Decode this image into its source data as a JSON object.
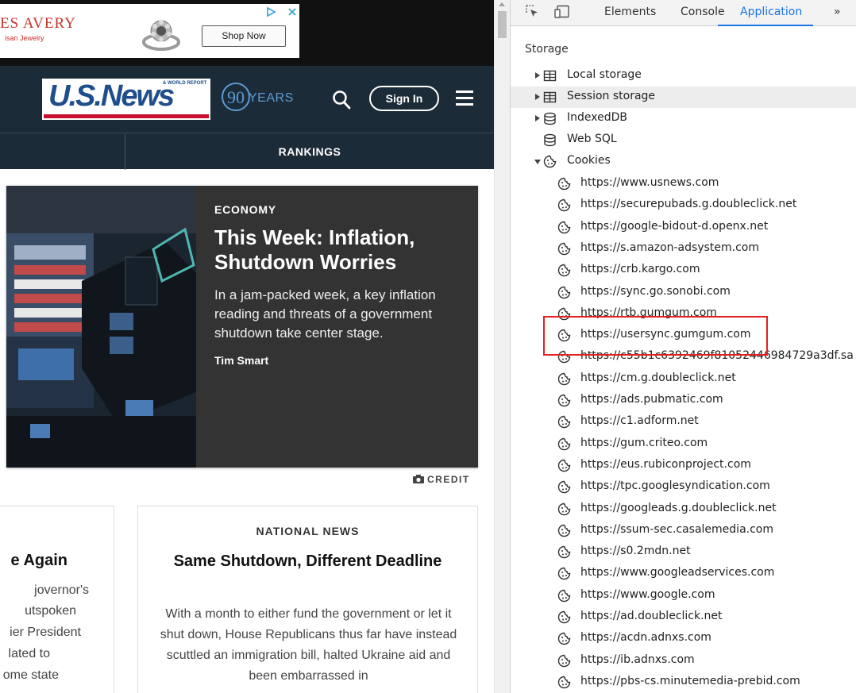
{
  "ad": {
    "brand": "ES AVERY",
    "tagline": "isan Jewelry",
    "shop_label": "Shop Now"
  },
  "site": {
    "logo_text": "U.S.News",
    "logo_small": "& WORLD REPORT",
    "anniversary_number": "90",
    "anniversary_label": "YEARS",
    "signin_label": "Sign In",
    "nav_item": "RANKINGS"
  },
  "hero": {
    "kicker": "ECONOMY",
    "title": "This Week: Inflation, Shutdown Worries",
    "summary": "In a jam-packed week, a key inflation reading and threats of a government shutdown take center stage.",
    "author": "Tim Smart",
    "credit": "CREDIT"
  },
  "card_left": {
    "title": "e Again",
    "lines": [
      "jovernor's",
      "utspoken",
      "ier President",
      "lated to",
      "ome state"
    ]
  },
  "card_right": {
    "kicker": "NATIONAL NEWS",
    "title": "Same Shutdown, Different Deadline",
    "summary": "With a month to either fund the government or let it shut down, House Republicans thus far have instead scuttled an immigration bill, halted Ukraine aid and been embarrassed in"
  },
  "devtools": {
    "tabs": [
      {
        "label": "Elements",
        "active": false
      },
      {
        "label": "Console",
        "active": false
      },
      {
        "label": "Application",
        "active": true
      }
    ],
    "more_tabs": "»",
    "storage_heading": "Storage",
    "storage_items": [
      {
        "label": "Local storage",
        "icon": "table-icon",
        "expanded": false
      },
      {
        "label": "Session storage",
        "icon": "table-icon",
        "expanded": false
      },
      {
        "label": "IndexedDB",
        "icon": "database-icon",
        "expanded": false
      },
      {
        "label": "Web SQL",
        "icon": "database-icon",
        "expanded": null
      },
      {
        "label": "Cookies",
        "icon": "cookie-icon",
        "expanded": true
      }
    ],
    "cookie_origins": [
      "https://www.usnews.com",
      "https://securepubads.g.doubleclick.net",
      "https://google-bidout-d.openx.net",
      "https://s.amazon-adsystem.com",
      "https://crb.kargo.com",
      "https://sync.go.sonobi.com",
      "https://rtb.gumgum.com",
      "https://usersync.gumgum.com",
      "https://c55b1c6392469f81052446984729a3df.sa",
      "https://cm.g.doubleclick.net",
      "https://ads.pubmatic.com",
      "https://c1.adform.net",
      "https://gum.criteo.com",
      "https://eus.rubiconproject.com",
      "https://tpc.googlesyndication.com",
      "https://googleads.g.doubleclick.net",
      "https://ssum-sec.casalemedia.com",
      "https://s0.2mdn.net",
      "https://www.googleadservices.com",
      "https://www.google.com",
      "https://ad.doubleclick.net",
      "https://acdn.adnxs.com",
      "https://ib.adnxs.com",
      "https://pbs-cs.minutemedia-prebid.com"
    ],
    "highlighted_origin": "https://usersync.gumgum.com",
    "highlight_color": "#e32020",
    "accent_color": "#1a73e8"
  }
}
